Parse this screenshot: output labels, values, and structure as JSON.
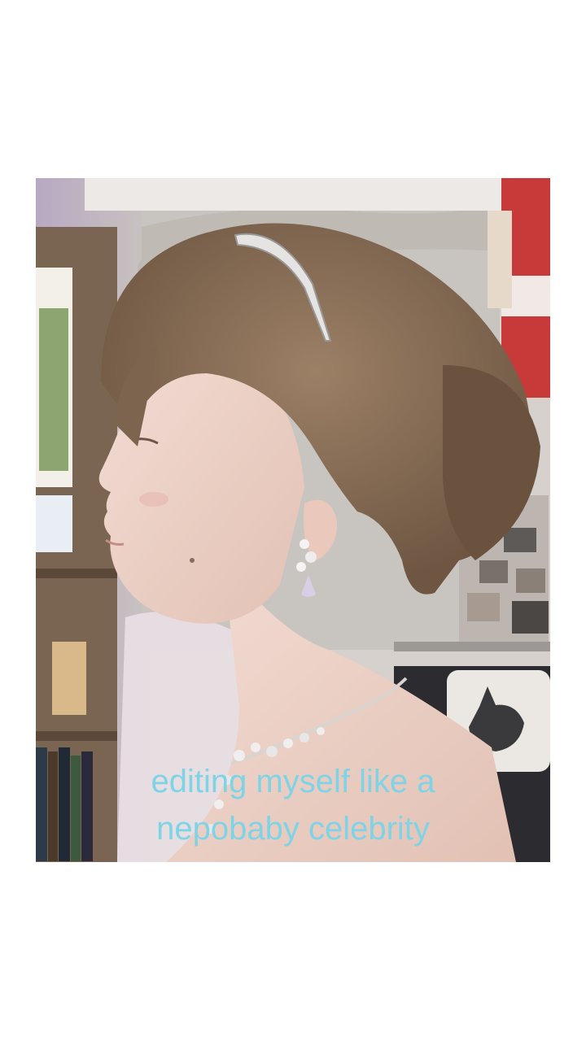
{
  "caption": {
    "line1": "editing myself like a",
    "line2": "nepobaby celebrity"
  },
  "colors": {
    "caption_text": "#7fd3e6",
    "background": "#ffffff"
  },
  "photo": {
    "subject": "profile-portrait"
  }
}
